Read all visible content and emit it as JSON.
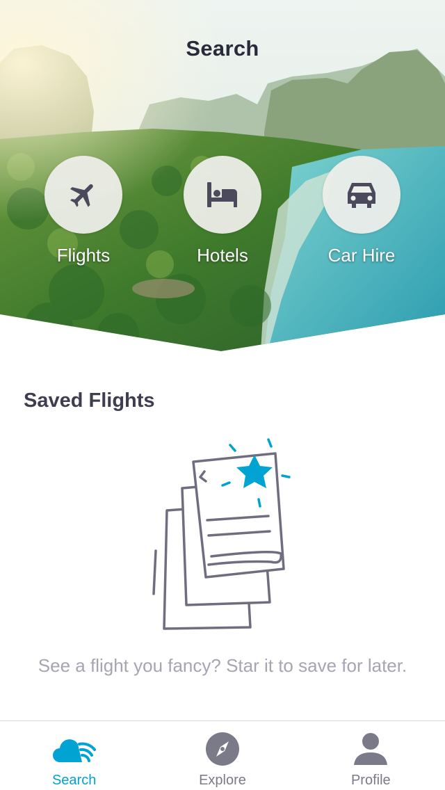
{
  "header": {
    "title": "Search"
  },
  "categories": [
    {
      "label": "Flights",
      "icon": "airplane-icon"
    },
    {
      "label": "Hotels",
      "icon": "bed-icon"
    },
    {
      "label": "Car Hire",
      "icon": "car-icon"
    }
  ],
  "saved": {
    "title": "Saved Flights",
    "empty_message": "See a flight you fancy? Star it to save for later.",
    "illustration_icon": "starred-tickets-icon"
  },
  "tabbar": {
    "items": [
      {
        "label": "Search",
        "icon": "skyscanner-cloud-icon",
        "active": true
      },
      {
        "label": "Explore",
        "icon": "compass-icon",
        "active": false
      },
      {
        "label": "Profile",
        "icon": "person-icon",
        "active": false
      }
    ]
  },
  "colors": {
    "accent": "#00a3d2",
    "title_text": "#2b2a3a",
    "muted_text": "#a6a5b2",
    "icon_dark": "#4a4a5c",
    "tab_inactive": "#7b7a88"
  }
}
